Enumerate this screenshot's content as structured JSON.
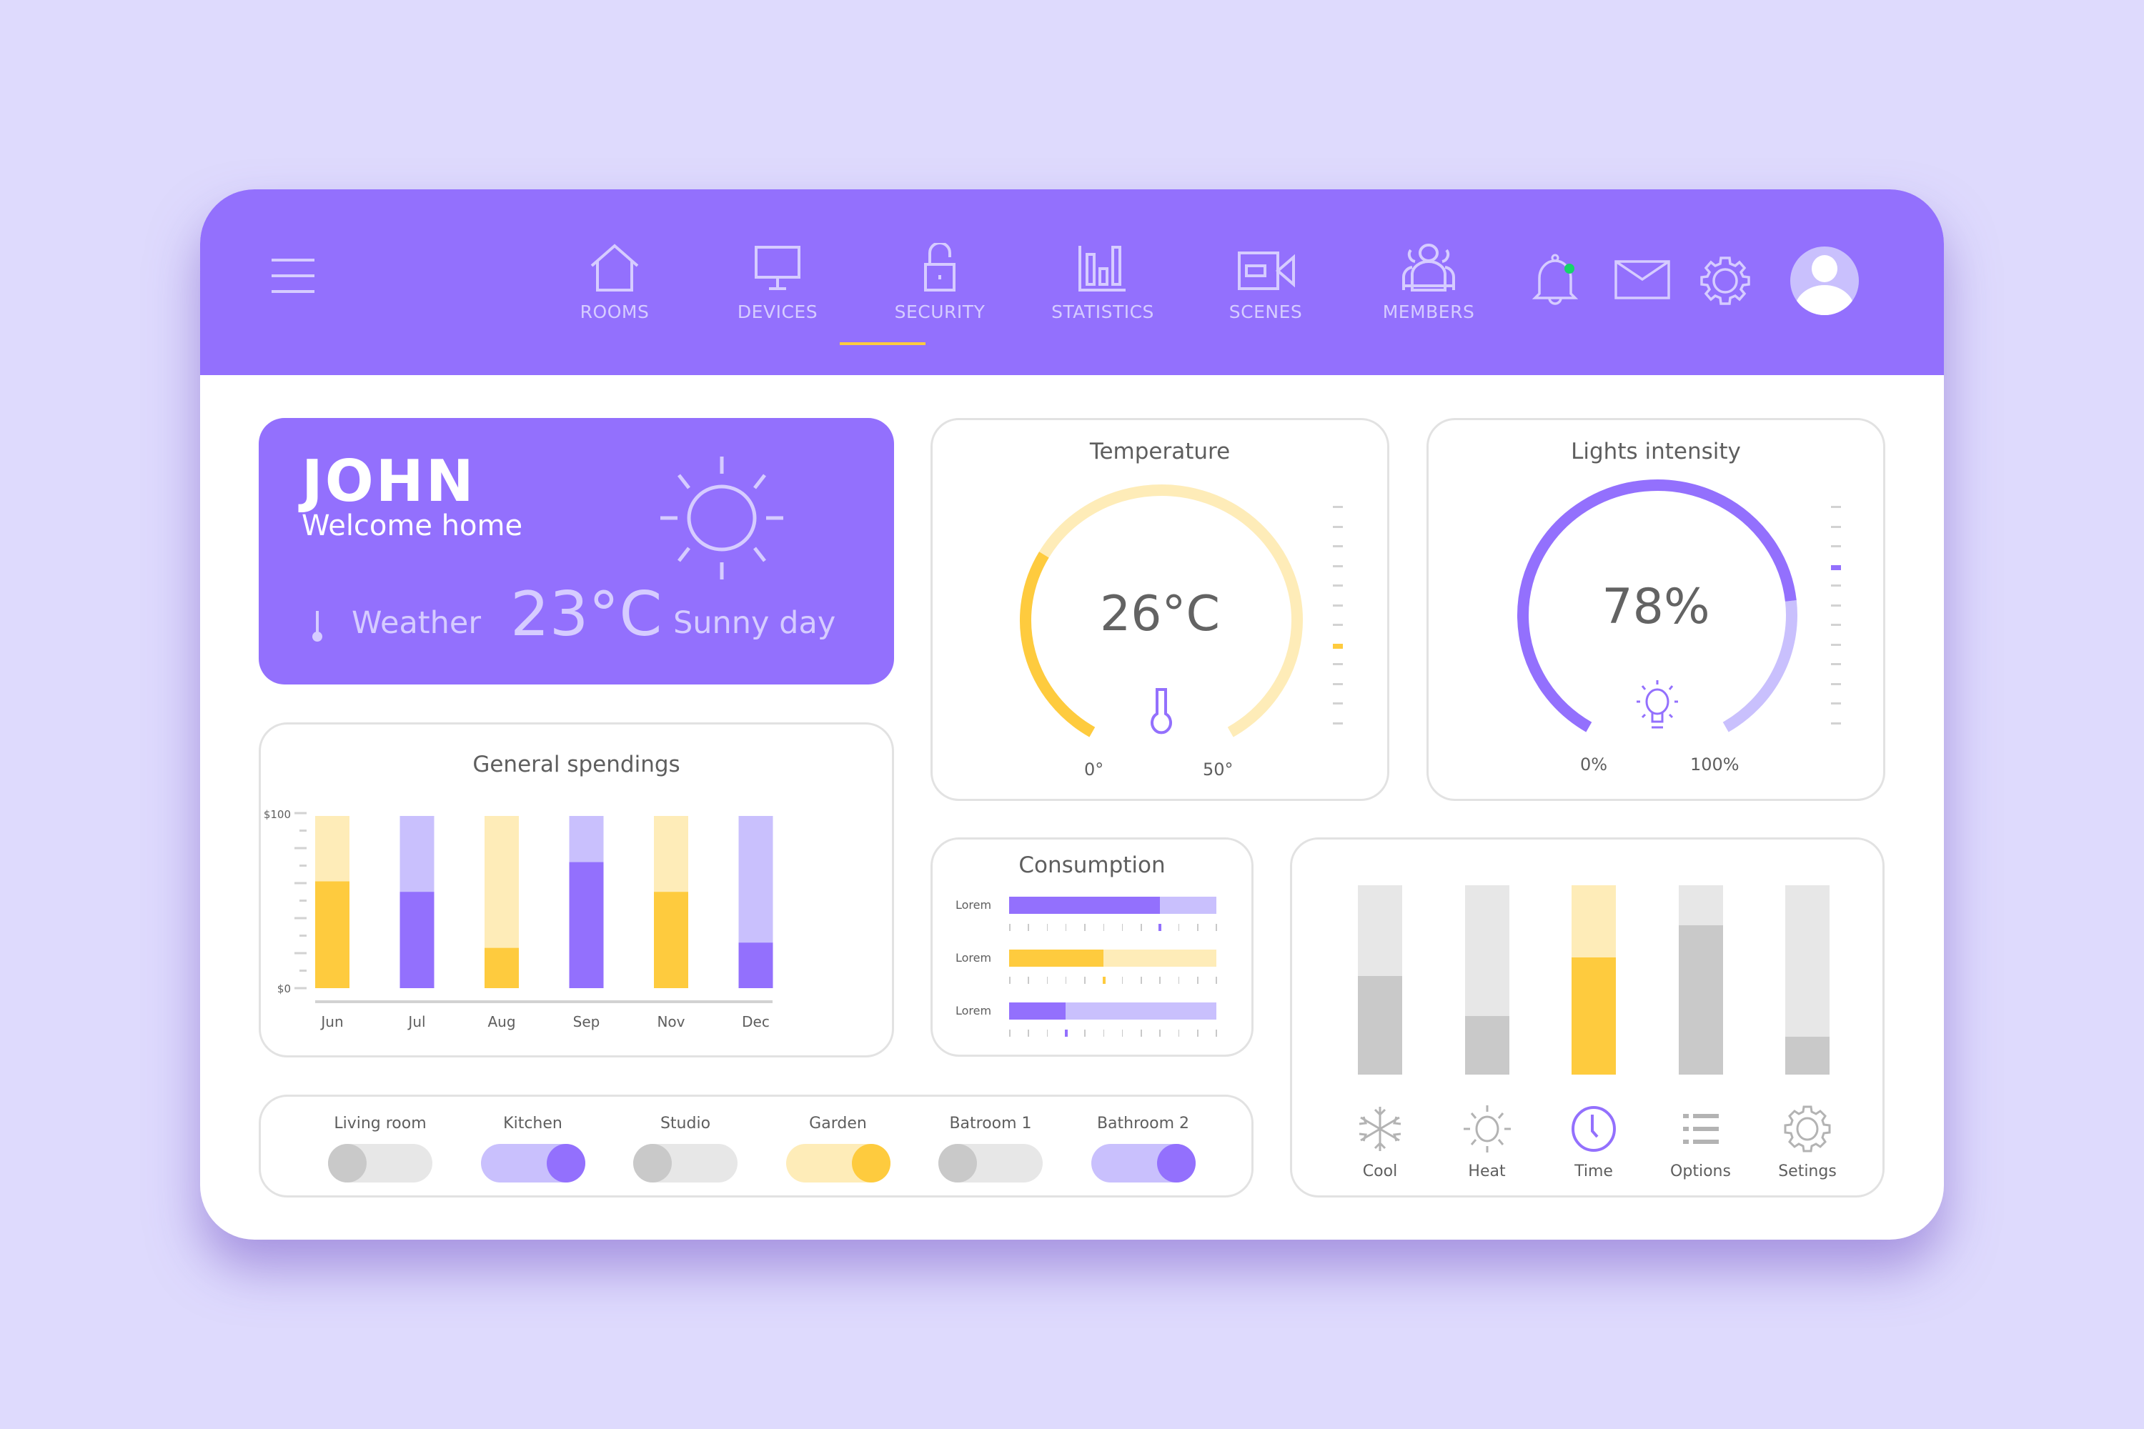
{
  "colors": {
    "primary": "#9370fd",
    "primary_light": "#c9c0fd",
    "accent_yellow": "#fecb3e",
    "yellow_light": "#feecb8",
    "gray": "#c9c9c9",
    "gray_light": "#e7e7e7",
    "notification_dot": "#16d46a",
    "background": "#dedafd"
  },
  "header": {
    "menu_icon": "hamburger-icon",
    "nav": [
      {
        "label": "ROOMS",
        "icon": "home-icon",
        "active": false
      },
      {
        "label": "DEVICES",
        "icon": "monitor-icon",
        "active": false
      },
      {
        "label": "SECURITY",
        "icon": "lock-icon",
        "active": false
      },
      {
        "label": "STATISTICS",
        "icon": "bar-chart-icon",
        "active": true
      },
      {
        "label": "SCENES",
        "icon": "video-camera-icon",
        "active": false
      },
      {
        "label": "MEMBERS",
        "icon": "users-icon",
        "active": false
      }
    ],
    "actions": [
      {
        "icon": "bell-icon",
        "has_notification": true
      },
      {
        "icon": "mail-icon"
      },
      {
        "icon": "gear-icon"
      },
      {
        "icon": "user-avatar-icon"
      }
    ]
  },
  "welcome": {
    "name": "JOHN",
    "greeting": "Welcome home",
    "weather_label": "Weather",
    "temperature": "23°C",
    "condition": "Sunny day",
    "weather_icon": "sun-icon"
  },
  "temperature": {
    "title": "Temperature",
    "value": "26°C",
    "min_label": "0°",
    "max_label": "50°",
    "fraction": 0.3,
    "icon": "thermometer-icon",
    "scale_ticks": 12,
    "scale_active_index": 7
  },
  "lights": {
    "title": "Lights intensity",
    "value": "78%",
    "min_label": "0%",
    "max_label": "100%",
    "fraction": 0.78,
    "icon": "lightbulb-icon",
    "scale_ticks": 12,
    "scale_active_index": 3
  },
  "chart_data": {
    "type": "bar",
    "title": "General spendings",
    "categories": [
      "Jun",
      "Jul",
      "Aug",
      "Sep",
      "Nov",
      "Dec"
    ],
    "values": [
      61,
      55,
      23,
      72,
      55,
      26
    ],
    "max": [
      100,
      100,
      100,
      100,
      100,
      100
    ],
    "colors": [
      "yellow",
      "purple",
      "yellow",
      "purple",
      "yellow",
      "purple"
    ],
    "ylim": [
      0,
      100
    ],
    "y_tick_labels": [
      "$100",
      "$0"
    ],
    "xlabel": "",
    "ylabel": ""
  },
  "consumption": {
    "title": "Consumption",
    "rows": [
      {
        "label": "Lorem",
        "fraction": 0.727,
        "color": "purple",
        "marker_index": 8
      },
      {
        "label": "Lorem",
        "fraction": 0.455,
        "color": "yellow",
        "marker_index": 5
      },
      {
        "label": "Lorem",
        "fraction": 0.273,
        "color": "purple",
        "marker_index": 3
      }
    ],
    "ticks": 12
  },
  "rooms": [
    {
      "label": "Living room",
      "on": false,
      "color": "gray"
    },
    {
      "label": "Kitchen",
      "on": true,
      "color": "purple"
    },
    {
      "label": "Studio",
      "on": false,
      "color": "gray"
    },
    {
      "label": "Garden",
      "on": true,
      "color": "yellow"
    },
    {
      "label": "Batroom 1",
      "on": false,
      "color": "gray"
    },
    {
      "label": "Bathroom 2",
      "on": true,
      "color": "purple"
    }
  ],
  "controls": [
    {
      "label": "Cool",
      "icon": "snowflake-icon",
      "level": 0.52,
      "active": false
    },
    {
      "label": "Heat",
      "icon": "sun-icon",
      "level": 0.31,
      "active": false
    },
    {
      "label": "Time",
      "icon": "clock-icon",
      "level": 0.62,
      "active": true
    },
    {
      "label": "Options",
      "icon": "list-icon",
      "level": 0.79,
      "active": false
    },
    {
      "label": "Setings",
      "icon": "gear-icon",
      "level": 0.2,
      "active": false
    }
  ]
}
